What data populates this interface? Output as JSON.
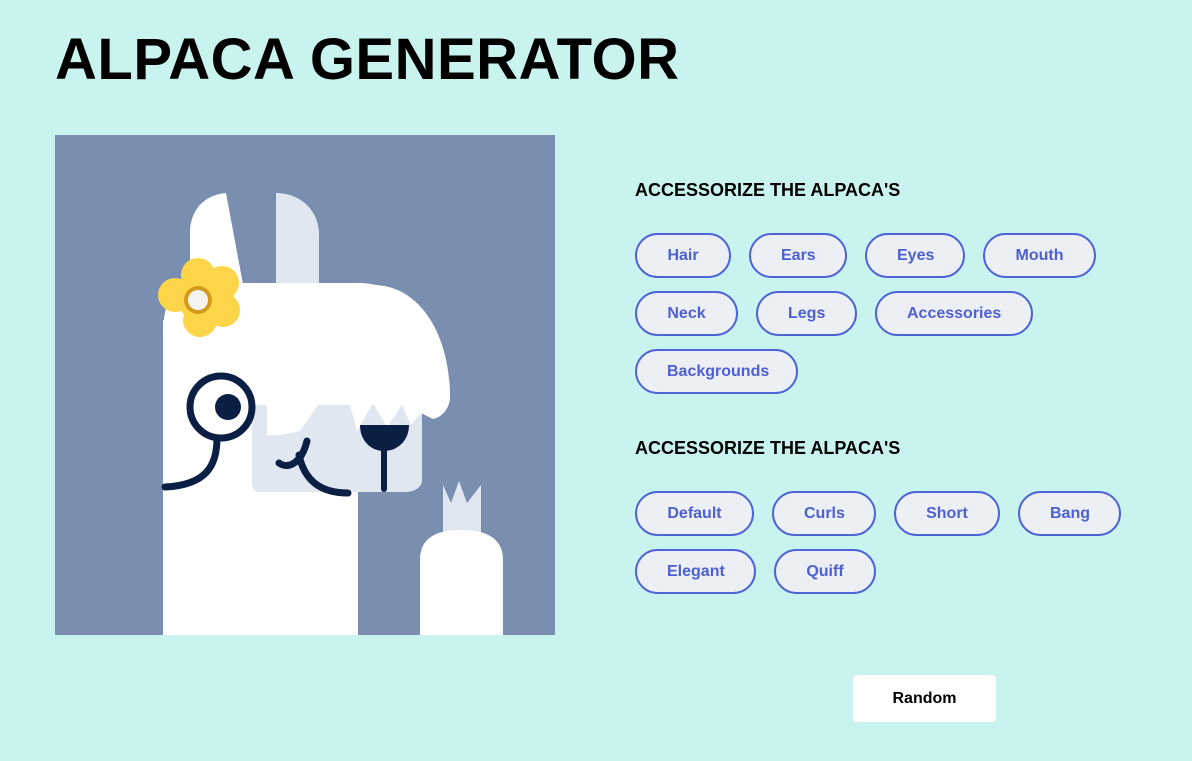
{
  "page": {
    "title": "ALPACA GENERATOR"
  },
  "accessorize_section": {
    "heading": "ACCESSORIZE THE ALPACA'S",
    "buttons": [
      {
        "label": "Hair"
      },
      {
        "label": "Ears"
      },
      {
        "label": "Eyes"
      },
      {
        "label": "Mouth"
      },
      {
        "label": "Neck"
      },
      {
        "label": "Legs"
      },
      {
        "label": "Accessories"
      },
      {
        "label": "Backgrounds"
      }
    ]
  },
  "style_section": {
    "heading": "ACCESSORIZE THE ALPACA'S",
    "buttons": [
      {
        "label": "Default"
      },
      {
        "label": "Curls"
      },
      {
        "label": "Short"
      },
      {
        "label": "Bang"
      },
      {
        "label": "Elegant"
      },
      {
        "label": "Quiff"
      }
    ]
  },
  "actions": {
    "random_label": "Random"
  },
  "colors": {
    "page_background": "#c9f3ef",
    "preview_background": "#7a8eb0",
    "button_border": "#4e63d6",
    "button_text": "#4e5fd3",
    "button_fill": "#eceff4",
    "alpaca_body": "#ffffff",
    "alpaca_shade": "#e0e7f1",
    "features": "#0b1f44",
    "flower_petals": "#fdd549",
    "flower_ring": "#d49a1c"
  },
  "preview": {
    "alpaca_parts": [
      "ears-hair",
      "flower-accessory",
      "eyes-monocle",
      "nose",
      "mouth",
      "neck",
      "leg"
    ]
  }
}
